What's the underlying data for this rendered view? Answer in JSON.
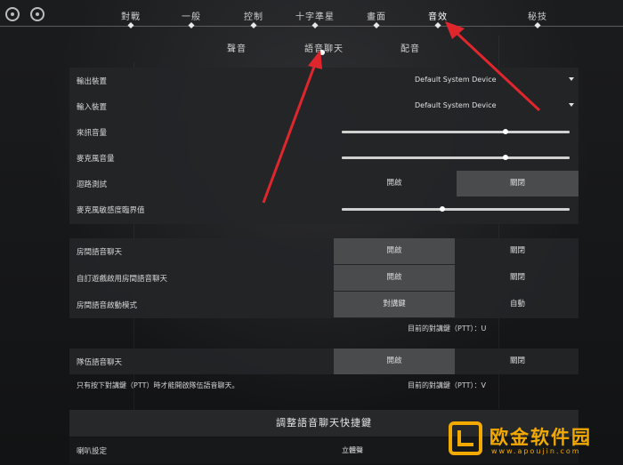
{
  "top_tabs": [
    "對戰",
    "一般",
    "控制",
    "十字準星",
    "畫面",
    "音效",
    "秘技"
  ],
  "active_top_tab": "音效",
  "sub_tabs": [
    "聲音",
    "語音聊天",
    "配音"
  ],
  "active_sub_tab": "語音聊天",
  "devices": {
    "output_label": "輸出裝置",
    "output_value": "Default System Device",
    "input_label": "輸入裝置",
    "input_value": "Default System Device",
    "incoming_volume_label": "來訊音量",
    "incoming_volume_level": 0.72,
    "mic_volume_label": "麥克風音量",
    "mic_volume_level": 0.72,
    "loopback_label": "迴路測試",
    "loopback_on": "開啟",
    "loopback_off": "關閉",
    "mic_threshold_label": "麥克風敏感度臨界值",
    "mic_threshold_level": 0.44
  },
  "room_voice": {
    "room_chat_label": "房間語音聊天",
    "room_chat_on": "開啟",
    "room_chat_off": "關閉",
    "custom_game_label": "自訂遊戲啟用房間語音聊天",
    "custom_game_on": "開啟",
    "custom_game_off": "關閉",
    "activation_label": "房間語音啟動模式",
    "activation_ptt": "對講鍵",
    "activation_auto": "自動",
    "ptt_key_note": "目前的對講鍵（PTT）：U"
  },
  "team_voice": {
    "team_chat_label": "隊伍語音聊天",
    "team_chat_on": "開啟",
    "team_chat_off": "關閉",
    "ptt_only_note": "只有按下對講鍵（PTT）時才能開啟隊伍語音聊天。",
    "ptt_key_note": "目前的對講鍵（PTT）：V"
  },
  "shortcut_section_title": "調整語音聊天快捷鍵",
  "speaker": {
    "label": "喇叭設定",
    "value": "立體聲"
  },
  "watermark": {
    "title": "欧金软件园",
    "subtitle": "www.apoujin.com"
  },
  "colors": {
    "arrow": "#e0262d",
    "watermark": "#f2a900"
  }
}
